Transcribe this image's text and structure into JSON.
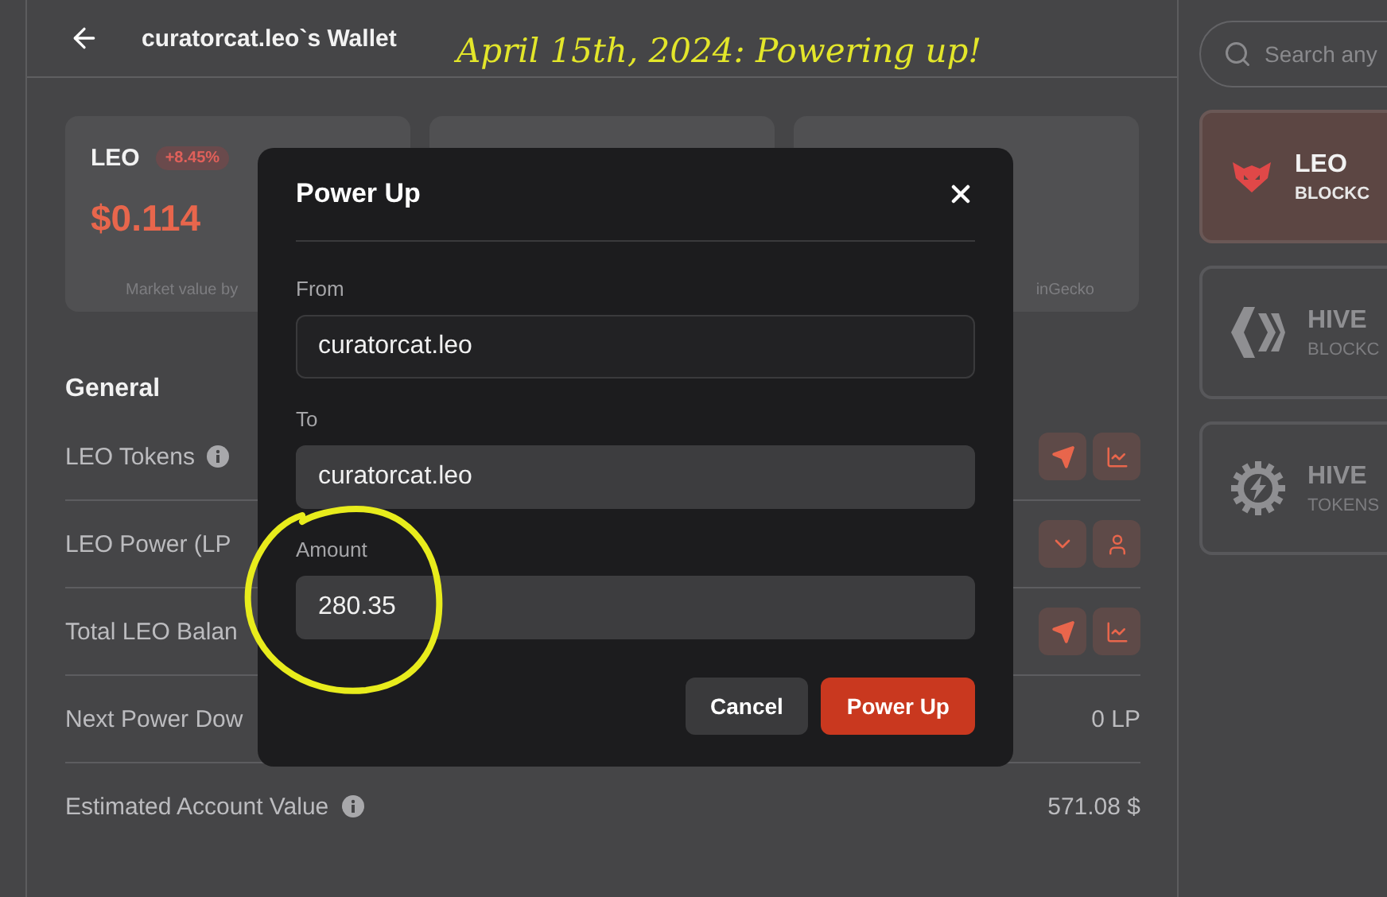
{
  "header": {
    "title": "curatorcat.leo`s Wallet"
  },
  "annotation": {
    "text": "April 15th, 2024: Powering up!"
  },
  "price_cards": [
    {
      "kind": "token",
      "symbol": "LEO",
      "change": "+8.45%",
      "price": "$0.114",
      "footer": "Market value by"
    },
    {
      "kind": "blank"
    },
    {
      "kind": "source",
      "footer": "inGecko"
    }
  ],
  "general": {
    "title": "General",
    "rows": [
      {
        "kind": "transfer",
        "label": "LEO Tokens",
        "info": true
      },
      {
        "kind": "power",
        "label": "LEO Power (LP",
        "info": false
      },
      {
        "kind": "transfer",
        "label": "Total LEO Balan",
        "info": false
      },
      {
        "kind": "value",
        "label": "Next Power Dow",
        "info": false,
        "value": "0 LP"
      },
      {
        "kind": "value",
        "label": "Estimated Account Value",
        "info": true,
        "value": "571.08 $"
      }
    ]
  },
  "modal": {
    "title": "Power Up",
    "fields": [
      {
        "label": "From",
        "value": "curatorcat.leo",
        "disabled": true
      },
      {
        "label": "To",
        "value": "curatorcat.leo",
        "disabled": false
      },
      {
        "label": "Amount",
        "value": "280.35",
        "disabled": false
      }
    ],
    "buttons": [
      {
        "label": "Cancel",
        "kind": "secondary"
      },
      {
        "label": "Power Up",
        "kind": "primary"
      }
    ]
  },
  "sidebar": {
    "search": {
      "placeholder": "Search any"
    },
    "tokens": [
      {
        "kind": "leo",
        "name": "LEO",
        "subtitle": "BLOCKC",
        "selected": true
      },
      {
        "kind": "hive",
        "name": "HIVE",
        "subtitle": "BLOCKC",
        "selected": false
      },
      {
        "kind": "engine",
        "name": "HIVE",
        "subtitle": "TOKENS",
        "selected": false
      }
    ]
  }
}
